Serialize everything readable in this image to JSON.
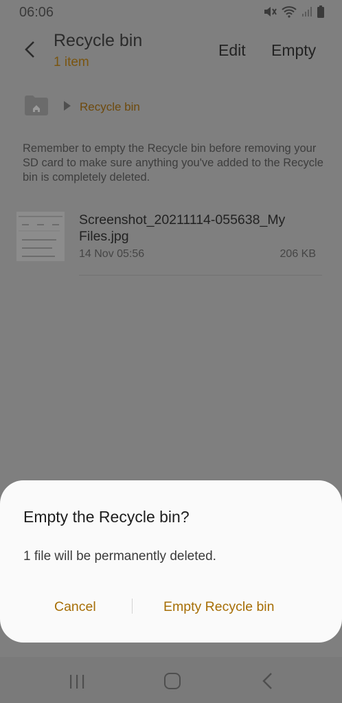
{
  "status_bar": {
    "time": "06:06"
  },
  "app_bar": {
    "title": "Recycle bin",
    "subtitle": "1 item",
    "edit_label": "Edit",
    "empty_label": "Empty"
  },
  "breadcrumb": {
    "current": "Recycle bin"
  },
  "notice": "Remember to empty the Recycle bin before removing your SD card to make sure anything you've added to the Recycle bin is completely deleted.",
  "files": [
    {
      "name": "Screenshot_20211114-055638_My Files.jpg",
      "date": "14 Nov 05:56",
      "size": "206 KB"
    }
  ],
  "dialog": {
    "title": "Empty the Recycle bin?",
    "message": "1 file will be permanently deleted.",
    "cancel_label": "Cancel",
    "confirm_label": "Empty Recycle bin"
  },
  "colors": {
    "accent": "#a66e05",
    "scrim": "#7f7f7f",
    "dialog_bg": "#fafafa"
  },
  "icons": [
    "back-arrow-icon",
    "home-folder-icon",
    "mute-icon",
    "wifi-icon",
    "signal-icon",
    "battery-icon",
    "recents-icon",
    "home-icon",
    "nav-back-icon"
  ]
}
